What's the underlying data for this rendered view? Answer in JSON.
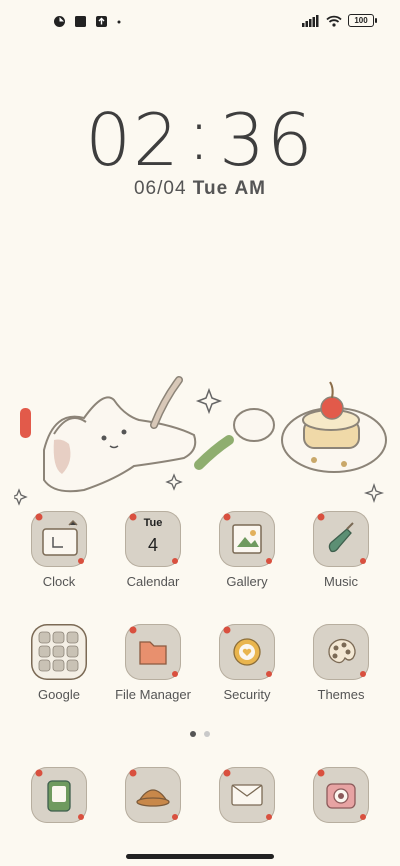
{
  "status_bar": {
    "battery": "100",
    "left_icons": [
      "notification-dot-icon",
      "square-icon",
      "upload-icon",
      "dot-icon"
    ],
    "right_icons": [
      "signal-icon",
      "wifi-icon",
      "battery-icon"
    ]
  },
  "lockscreen": {
    "hour": "02",
    "minute": "36",
    "date": "06/04",
    "weekday": "Tue",
    "ampm": "AM"
  },
  "apps_row1": [
    {
      "label": "Clock",
      "icon": "clock-app-icon"
    },
    {
      "label": "Calendar",
      "icon": "calendar-app-icon",
      "day": "Tue",
      "date": "4"
    },
    {
      "label": "Gallery",
      "icon": "gallery-app-icon"
    },
    {
      "label": "Music",
      "icon": "music-app-icon"
    }
  ],
  "apps_row2": [
    {
      "label": "Google",
      "icon": "google-folder-icon"
    },
    {
      "label": "File Manager",
      "icon": "file-manager-app-icon"
    },
    {
      "label": "Security",
      "icon": "security-app-icon"
    },
    {
      "label": "Themes",
      "icon": "themes-app-icon"
    }
  ],
  "dock": [
    {
      "icon": "phone-app-icon"
    },
    {
      "icon": "browser-app-icon"
    },
    {
      "icon": "messages-app-icon"
    },
    {
      "icon": "camera-app-icon"
    }
  ],
  "page_indicator": {
    "pages": 2,
    "active": 0
  },
  "colors": {
    "background": "#fcf9f1",
    "tile": "#d8d2c7",
    "accent_red": "#d9503f"
  }
}
